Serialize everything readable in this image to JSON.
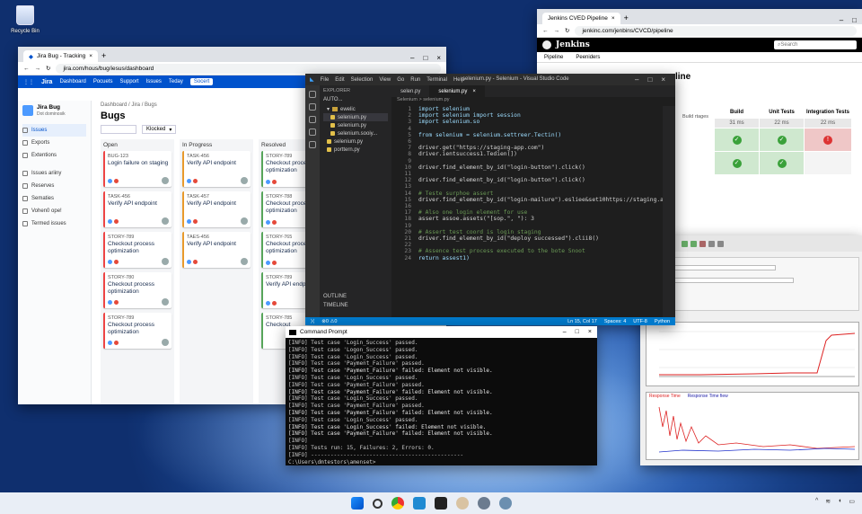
{
  "desktop": {
    "recycle_bin": "Recycle Bin"
  },
  "jira": {
    "tab_title": "Jira Bug - Tracking",
    "url": "jira.com/hous/bug/iesus/dashboard",
    "nav": {
      "logo": "Jira",
      "items": [
        "Dashboard",
        "Pocuets",
        "Support",
        "Issues",
        "Teday"
      ],
      "button": "Socert"
    },
    "project": {
      "name": "Jira Bug",
      "sub": "Dot dominosik"
    },
    "sidebar": [
      "Issues",
      "Exports",
      "Extentions",
      "Issues ariiny",
      "Reserves",
      "Sematies",
      "Vohen0 ope!",
      "Termed issues"
    ],
    "breadcrumb": "Dashboard  /  Jira  /  Bugs",
    "title": "Bugs",
    "filter": "Klocked",
    "columns": [
      {
        "name": "Open",
        "cards": [
          {
            "key": "BUG-123",
            "title": "Login failure on staging"
          },
          {
            "key": "TASK-456",
            "title": "Verify API endpoint"
          },
          {
            "key": "STORY-789",
            "title": "Checkout process optimization"
          },
          {
            "key": "STORY-780",
            "title": "Checkout process optimization"
          },
          {
            "key": "STORY-789",
            "title": "Checkout process optimization"
          }
        ]
      },
      {
        "name": "In Progress",
        "cards": [
          {
            "key": "TASK-456",
            "title": "Verify API endpoint"
          },
          {
            "key": "TASK-457",
            "title": "Verify API endpoint"
          },
          {
            "key": "TAES-456",
            "title": "Verify API endpoint"
          }
        ]
      },
      {
        "name": "Resolved",
        "cards": [
          {
            "key": "STORY-789",
            "title": "Checkout process optimization"
          },
          {
            "key": "STORY-788",
            "title": "Checkout process optimization"
          },
          {
            "key": "STORY-765",
            "title": "Checkout process optimization"
          },
          {
            "key": "STORY-789",
            "title": "Verify API endpoint"
          },
          {
            "key": "STORY-785",
            "title": "Checkout"
          }
        ]
      }
    ]
  },
  "jenkins": {
    "tab_title": "Jenkins CVED Pipeline",
    "url": "jenkinc.com/jenbins/CVCD/pipeline",
    "brand": "Jenkins",
    "search": "Search",
    "crumbs": [
      "Pipeline",
      "Peeniders"
    ],
    "heading": "line",
    "stage_label": "Build rtages",
    "stages": [
      {
        "name": "Build",
        "time": "31 ms",
        "results": [
          "ok",
          "ok"
        ]
      },
      {
        "name": "Unit Tests",
        "time": "22 ms",
        "results": [
          "ok",
          "ok"
        ]
      },
      {
        "name": "Integration Tests",
        "time": "22 ms",
        "results": [
          "fail",
          ""
        ]
      }
    ]
  },
  "vscode": {
    "menu": [
      "File",
      "Edit",
      "Selection",
      "View",
      "Go",
      "Run",
      "Terminal",
      "Help"
    ],
    "title": "selenium.py - Selenium - Visual Studio Code",
    "explorer": {
      "header": "EXPLORER",
      "root": "AUTO...",
      "folder": "ewelic",
      "files": [
        "selenium.py",
        "selenium.py",
        "selenium.sooiy...",
        "selenium.py",
        "porttern.py"
      ],
      "outline": "OUTLINE",
      "timeline": "TIMELINE"
    },
    "tabs": [
      "selen.py",
      "selenium.py"
    ],
    "breadcrumb": "Selenium > selenium.py",
    "code": [
      {
        "n": "1",
        "t": "import selenium"
      },
      {
        "n": "2",
        "t": "import selenium import session"
      },
      {
        "n": "3",
        "t": "import selenium.so"
      },
      {
        "n": "4",
        "t": ""
      },
      {
        "n": "5",
        "t": "from selenium = selenium.settreer.Tectin()"
      },
      {
        "n": "6",
        "t": ""
      },
      {
        "n": "7",
        "t": "driver.get(\"https://staging-app.com\")"
      },
      {
        "n": "8",
        "t": "driver.ientsuccess1.Tedien(])"
      },
      {
        "n": "9",
        "t": ""
      },
      {
        "n": "10",
        "t": "driver.find_element_by_id(\"login-button\").click()"
      },
      {
        "n": "11",
        "t": ""
      },
      {
        "n": "12",
        "t": "driver.find_element_by_id(\"login-button\").click()"
      },
      {
        "n": "13",
        "t": ""
      },
      {
        "n": "14",
        "t": "# Teste surphoe assert"
      },
      {
        "n": "15",
        "t": "driver.find_element_by_id(\"login-mailure\").esliee&set10https://staging.aer"
      },
      {
        "n": "16",
        "t": ""
      },
      {
        "n": "17",
        "t": "# Also one login element for use"
      },
      {
        "n": "18",
        "t": "assert assoe.assets(\"[sop.\", \"): 3"
      },
      {
        "n": "19",
        "t": ""
      },
      {
        "n": "20",
        "t": "# Assert test coord is login staging"
      },
      {
        "n": "21",
        "t": "driver.find_element_by_id(\"deploy successed\").clii8()"
      },
      {
        "n": "22",
        "t": ""
      },
      {
        "n": "23",
        "t": "# Assence test process executed to the bote Snoot"
      },
      {
        "n": "24",
        "t": "return assest1)"
      }
    ],
    "status": {
      "pos": "Ln 15, Col 17",
      "spaces": "Spaces: 4",
      "enc": "UTF-8",
      "lang": "Python"
    }
  },
  "cmd": {
    "title": "Command Prompt",
    "lines": [
      "[INFO] Test case 'Login_Success' passed.",
      "[INFO] Test case 'Logon_Success' passed.",
      "[INFO] Test case 'Login_Success' passed.",
      "[INFO] Test case 'Payment_Failure' passed.",
      "[INFO] Test case 'Payment_Failure' failed: Element not visible.",
      "[INFO] Test case 'Login_Success' passed.",
      "[INFO] Test case 'Payment_Failure' passed.",
      "[INFO] Test case 'Payment_Failure' failed: Element not visible.",
      "[INFO] Test case 'Login_Success' passed.",
      "[INFO] Test case 'Payment_Failure' passed.",
      "[INFO] Test case 'Payment_Failure' failed: Element not visible.",
      "[INFO] Test case 'Login_Success' passed.",
      "[INFO] Test case 'Login_Success' failed: Element not visible.",
      "[INFO] Test case 'Payment_Failure' failed: Element not visible.",
      "[INFO]",
      "[INFO] Tests run: 15, Failures: 2, Errors: 0.",
      "[INFO] -----------------------------------------------",
      "C:\\Users\\dmtestors\\amenset>"
    ]
  },
  "perf": {
    "legend1": "Response Time",
    "legend2": "Response Time fiew"
  },
  "colors": {
    "jira_blue": "#0052cc",
    "jenkins_black": "#000000",
    "vscode_blue": "#007acc",
    "ok": "#3aa13a",
    "fail": "#d33333"
  }
}
